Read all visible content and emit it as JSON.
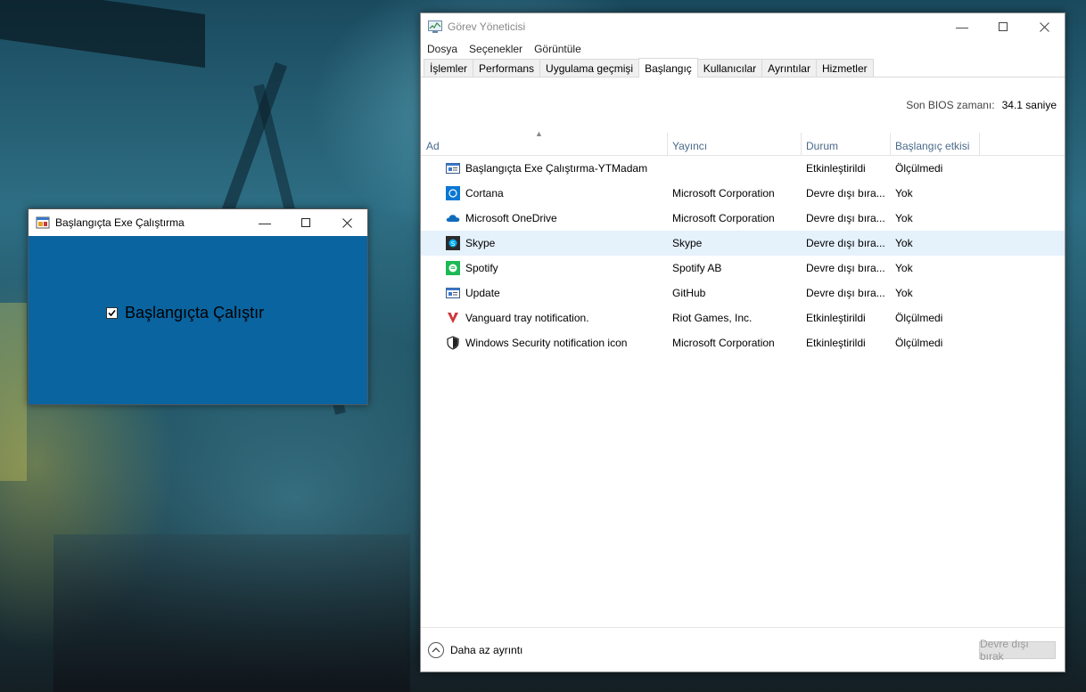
{
  "app_window": {
    "title": "Başlangıçta Exe Çalıştırma",
    "checkbox_label": "Başlangıçta Çalıştır",
    "checkbox_checked": true,
    "body_color": "#0a64a0"
  },
  "task_manager": {
    "title": "Görev Yöneticisi",
    "menu": [
      "Dosya",
      "Seçenekler",
      "Görüntüle"
    ],
    "tabs": [
      "İşlemler",
      "Performans",
      "Uygulama geçmişi",
      "Başlangıç",
      "Kullanıcılar",
      "Ayrıntılar",
      "Hizmetler"
    ],
    "active_tab": "Başlangıç",
    "bios_label": "Son BIOS zamanı:",
    "bios_value": "34.1 saniye",
    "columns": [
      "Ad",
      "Yayıncı",
      "Durum",
      "Başlangıç etkisi"
    ],
    "rows": [
      {
        "name": "Başlangıçta Exe Çalıştırma-YTMadam",
        "publisher": "",
        "status": "Etkinleştirildi",
        "impact": "Ölçülmedi",
        "icon": "app-window-icon"
      },
      {
        "name": "Cortana",
        "publisher": "Microsoft Corporation",
        "status": "Devre dışı bıra...",
        "impact": "Yok",
        "icon": "cortana-icon"
      },
      {
        "name": "Microsoft OneDrive",
        "publisher": "Microsoft Corporation",
        "status": "Devre dışı bıra...",
        "impact": "Yok",
        "icon": "onedrive-cloud-icon"
      },
      {
        "name": "Skype",
        "publisher": "Skype",
        "status": "Devre dışı bıra...",
        "impact": "Yok",
        "icon": "skype-icon"
      },
      {
        "name": "Spotify",
        "publisher": "Spotify AB",
        "status": "Devre dışı bıra...",
        "impact": "Yok",
        "icon": "spotify-icon"
      },
      {
        "name": "Update",
        "publisher": "GitHub",
        "status": "Devre dışı bıra...",
        "impact": "Yok",
        "icon": "update-app-icon"
      },
      {
        "name": "Vanguard tray notification.",
        "publisher": "Riot Games, Inc.",
        "status": "Etkinleştirildi",
        "impact": "Ölçülmedi",
        "icon": "vanguard-icon"
      },
      {
        "name": "Windows Security notification icon",
        "publisher": "Microsoft Corporation",
        "status": "Etkinleştirildi",
        "impact": "Ölçülmedi",
        "icon": "shield-icon"
      }
    ],
    "selected_row": 3,
    "fewer_details": "Daha az ayrıntı",
    "disable_button": "Devre dışı bırak"
  }
}
